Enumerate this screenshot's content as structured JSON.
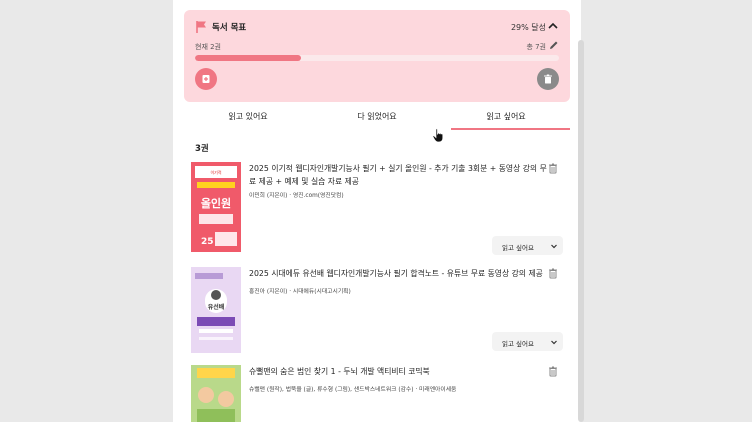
{
  "goal": {
    "cutoff_title": "독서 목표",
    "title": "독서 목표",
    "percent_label": "29% 달성",
    "current_label": "현재 2권",
    "total_label": "총 7권",
    "progress_fraction": 0.29,
    "accent_color": "#f07683",
    "background_color": "#fdd8dd"
  },
  "tabs": [
    {
      "label": "읽고 있어요"
    },
    {
      "label": "다 읽었어요"
    },
    {
      "label": "읽고 싶어요",
      "active": true
    }
  ],
  "list": {
    "count_label": "3권",
    "books": [
      {
        "title": "2025 이기적 웹디자인개발기능사 필기 + 실기 올인원 - 추가 기출 3회분 + 동영상 강의 무료 제공 + 예제 및 실습 자료 제공",
        "author": "이민희 (지은이) · 영진.com(영진닷컴)",
        "status": "읽고 싶어요",
        "cover_text": "이기적 웹디자인개발기능사 올인원 25"
      },
      {
        "title": "2025 시대에듀 유선배 웹디자인개발기능사 필기 합격노트 - 유튜브 무료 동영상 강의 제공",
        "author": "홍진아 (지은이) · 시대에듀(시대고시기획)",
        "status": "읽고 싶어요",
        "cover_text": "유선배 웹디자인개발기능사 필기 합격노트"
      },
      {
        "title": "슈뻘맨의 숨은 범인 찾기 1 - 두뇌 개발 액티비티 코믹북",
        "author": "슈뻘맨 (원작), 법뚝을 (글), 류수형 (그림), 샌드박스네트워크 (감수) · 미래엔아이세움",
        "status": "",
        "cover_text": "슈뻘맨"
      }
    ]
  }
}
